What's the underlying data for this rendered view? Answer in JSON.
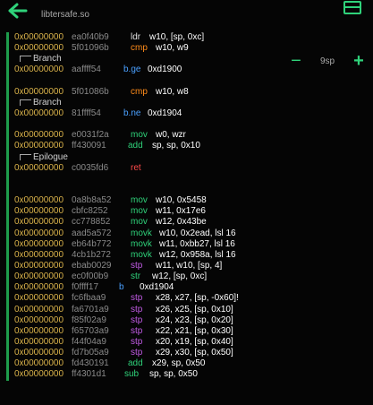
{
  "header": {
    "title": "libtersafe.so",
    "back_icon": "arrow-left-icon",
    "panel_icon": "panel-icon",
    "accent": "#2fd27a"
  },
  "zoom": {
    "minus": "−",
    "value": "9sp",
    "plus": "+"
  },
  "colors": {
    "address": "#d9b24a",
    "bytes": "#8a8a8a",
    "operand": "#ffffff",
    "number": "#7ee081",
    "mn_cmp": "#ff8c1a",
    "mn_mov": "#2fd27a",
    "mn_stp": "#c25be6",
    "mn_ldr": "#e0e0e0",
    "mn_branch": "#4aa0ff",
    "mn_ret": "#ff4a4a"
  },
  "rows": [
    {
      "kind": "inst",
      "addr": "0x00000000",
      "bytes": "ea0f40b9",
      "mn": "ldr",
      "ops": "w10, [sp, 0xc]",
      "mc": "#e0e0e0"
    },
    {
      "kind": "inst",
      "addr": "0x00000000",
      "bytes": "5f01096b",
      "mn": "cmp",
      "ops": "w10, w9",
      "mc": "#ff8c1a"
    },
    {
      "kind": "label",
      "text": "Branch"
    },
    {
      "kind": "inst",
      "addr": "0x00000000",
      "bytes": "aaffff54",
      "mn": "b.ge",
      "ops": "0xd1900",
      "mc": "#4aa0ff"
    },
    {
      "kind": "blank"
    },
    {
      "kind": "inst",
      "addr": "0x00000000",
      "bytes": "5f01086b",
      "mn": "cmp",
      "ops": "w10, w8",
      "mc": "#ff8c1a"
    },
    {
      "kind": "label",
      "text": "Branch"
    },
    {
      "kind": "inst",
      "addr": "0x00000000",
      "bytes": "81ffff54",
      "mn": "b.ne",
      "ops": "0xd1904",
      "mc": "#4aa0ff"
    },
    {
      "kind": "blank"
    },
    {
      "kind": "inst",
      "addr": "0x00000000",
      "bytes": "e0031f2a",
      "mn": "mov",
      "ops": "w0, wzr",
      "mc": "#2fd27a"
    },
    {
      "kind": "inst",
      "addr": "0x00000000",
      "bytes": "ff430091",
      "mn": "add",
      "ops": "sp, sp, 0x10",
      "mc": "#2fd27a"
    },
    {
      "kind": "label",
      "text": "Epilogue"
    },
    {
      "kind": "inst",
      "addr": "0x00000000",
      "bytes": "c0035fd6",
      "mn": "ret",
      "ops": "",
      "mc": "#ff4a4a"
    },
    {
      "kind": "blank"
    },
    {
      "kind": "blank"
    },
    {
      "kind": "inst",
      "addr": "0x00000000",
      "bytes": "0a8b8a52",
      "mn": "mov",
      "ops": "w10, 0x5458",
      "mc": "#2fd27a"
    },
    {
      "kind": "inst",
      "addr": "0x00000000",
      "bytes": "cbfc8252",
      "mn": "mov",
      "ops": "w11, 0x17e6",
      "mc": "#2fd27a"
    },
    {
      "kind": "inst",
      "addr": "0x00000000",
      "bytes": "cc778852",
      "mn": "mov",
      "ops": "w12, 0x43be",
      "mc": "#2fd27a"
    },
    {
      "kind": "inst",
      "addr": "0x00000000",
      "bytes": "aad5a572",
      "mn": "movk",
      "ops": "w10, 0x2ead, lsl 16",
      "mc": "#2fd27a"
    },
    {
      "kind": "inst",
      "addr": "0x00000000",
      "bytes": "eb64b772",
      "mn": "movk",
      "ops": "w11, 0xbb27, lsl 16",
      "mc": "#2fd27a"
    },
    {
      "kind": "inst",
      "addr": "0x00000000",
      "bytes": "4cb1b272",
      "mn": "movk",
      "ops": "w12, 0x958a, lsl 16",
      "mc": "#2fd27a"
    },
    {
      "kind": "inst",
      "addr": "0x00000000",
      "bytes": "ebab0029",
      "mn": "stp",
      "ops": "w11, w10, [sp, 4]",
      "mc": "#c25be6"
    },
    {
      "kind": "inst",
      "addr": "0x00000000",
      "bytes": "ec0f00b9",
      "mn": "str",
      "ops": "w12, [sp, 0xc]",
      "mc": "#2fd27a"
    },
    {
      "kind": "inst",
      "addr": "0x00000000",
      "bytes": "f0ffff17",
      "mn": "b",
      "ops": "0xd1904",
      "mc": "#4aa0ff"
    },
    {
      "kind": "inst",
      "addr": "0x00000000",
      "bytes": "fc6fbaa9",
      "mn": "stp",
      "ops": "x28, x27, [sp, -0x60]!",
      "mc": "#c25be6"
    },
    {
      "kind": "inst",
      "addr": "0x00000000",
      "bytes": "fa6701a9",
      "mn": "stp",
      "ops": "x26, x25, [sp, 0x10]",
      "mc": "#c25be6"
    },
    {
      "kind": "inst",
      "addr": "0x00000000",
      "bytes": "f85f02a9",
      "mn": "stp",
      "ops": "x24, x23, [sp, 0x20]",
      "mc": "#c25be6"
    },
    {
      "kind": "inst",
      "addr": "0x00000000",
      "bytes": "f65703a9",
      "mn": "stp",
      "ops": "x22, x21, [sp, 0x30]",
      "mc": "#c25be6"
    },
    {
      "kind": "inst",
      "addr": "0x00000000",
      "bytes": "f44f04a9",
      "mn": "stp",
      "ops": "x20, x19, [sp, 0x40]",
      "mc": "#c25be6"
    },
    {
      "kind": "inst",
      "addr": "0x00000000",
      "bytes": "fd7b05a9",
      "mn": "stp",
      "ops": "x29, x30, [sp, 0x50]",
      "mc": "#c25be6"
    },
    {
      "kind": "inst",
      "addr": "0x00000000",
      "bytes": "fd430191",
      "mn": "add",
      "ops": "x29, sp, 0x50",
      "mc": "#2fd27a"
    },
    {
      "kind": "inst",
      "addr": "0x00000000",
      "bytes": "ff4301d1",
      "mn": "sub",
      "ops": "sp, sp, 0x50",
      "mc": "#2fd27a"
    }
  ]
}
